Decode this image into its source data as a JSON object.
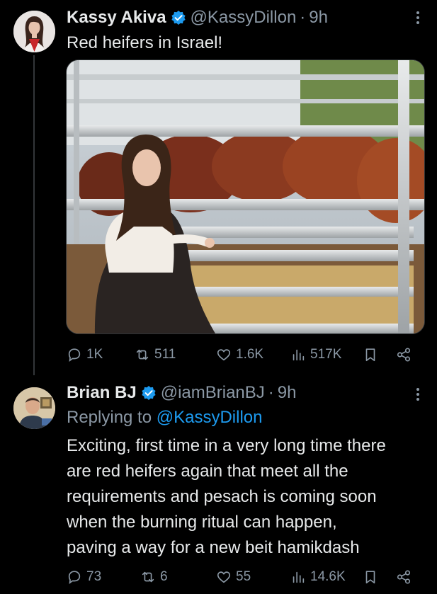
{
  "tweet": {
    "author_name": "Kassy Akiva",
    "handle": "@KassyDillon",
    "separator": "·",
    "time": "9h",
    "text": "Red heifers in Israel!",
    "stats": {
      "replies": "1K",
      "reposts": "511",
      "likes": "1.6K",
      "views": "517K"
    }
  },
  "reply": {
    "author_name": "Brian BJ",
    "handle": "@iamBrianBJ",
    "separator": "·",
    "time": "9h",
    "replying_prefix": "Replying to",
    "replying_to": "@KassyDillon",
    "lines": [
      "Exciting, first time in a very long time there",
      "are red heifers again that meet all the",
      "requirements and pesach is coming soon",
      "when the burning ritual can happen,",
      "paving a way for a new beit hamikdash"
    ],
    "stats": {
      "replies": "73",
      "reposts": "6",
      "likes": "55",
      "views": "14.6K"
    }
  },
  "colors": {
    "background": "#000000",
    "text": "#e7e9ea",
    "muted": "#8b98a5",
    "link": "#1d9bf0",
    "verified": "#1d9bf0"
  }
}
